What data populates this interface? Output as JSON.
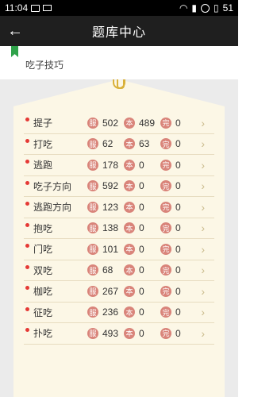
{
  "status_bar": {
    "time": "11:04",
    "battery": "51"
  },
  "app_bar": {
    "title": "题库中心"
  },
  "category": {
    "label": "吃子技巧"
  },
  "badges": {
    "fu": "服",
    "ben": "本",
    "wan": "完"
  },
  "colors": {
    "badge": "#d9847a",
    "dot": "#e53935",
    "paper": "#fcf7e6",
    "bookmark": "#2fa24a"
  },
  "items": [
    {
      "name": "提子",
      "fu": "502",
      "ben": "489",
      "wan": "0"
    },
    {
      "name": "打吃",
      "fu": "62",
      "ben": "63",
      "wan": "0"
    },
    {
      "name": "逃跑",
      "fu": "178",
      "ben": "0",
      "wan": "0"
    },
    {
      "name": "吃子方向",
      "fu": "592",
      "ben": "0",
      "wan": "0"
    },
    {
      "name": "逃跑方向",
      "fu": "123",
      "ben": "0",
      "wan": "0"
    },
    {
      "name": "抱吃",
      "fu": "138",
      "ben": "0",
      "wan": "0"
    },
    {
      "name": "门吃",
      "fu": "101",
      "ben": "0",
      "wan": "0"
    },
    {
      "name": "双吃",
      "fu": "68",
      "ben": "0",
      "wan": "0"
    },
    {
      "name": "枷吃",
      "fu": "267",
      "ben": "0",
      "wan": "0"
    },
    {
      "name": "征吃",
      "fu": "236",
      "ben": "0",
      "wan": "0"
    },
    {
      "name": "扑吃",
      "fu": "493",
      "ben": "0",
      "wan": "0"
    }
  ]
}
